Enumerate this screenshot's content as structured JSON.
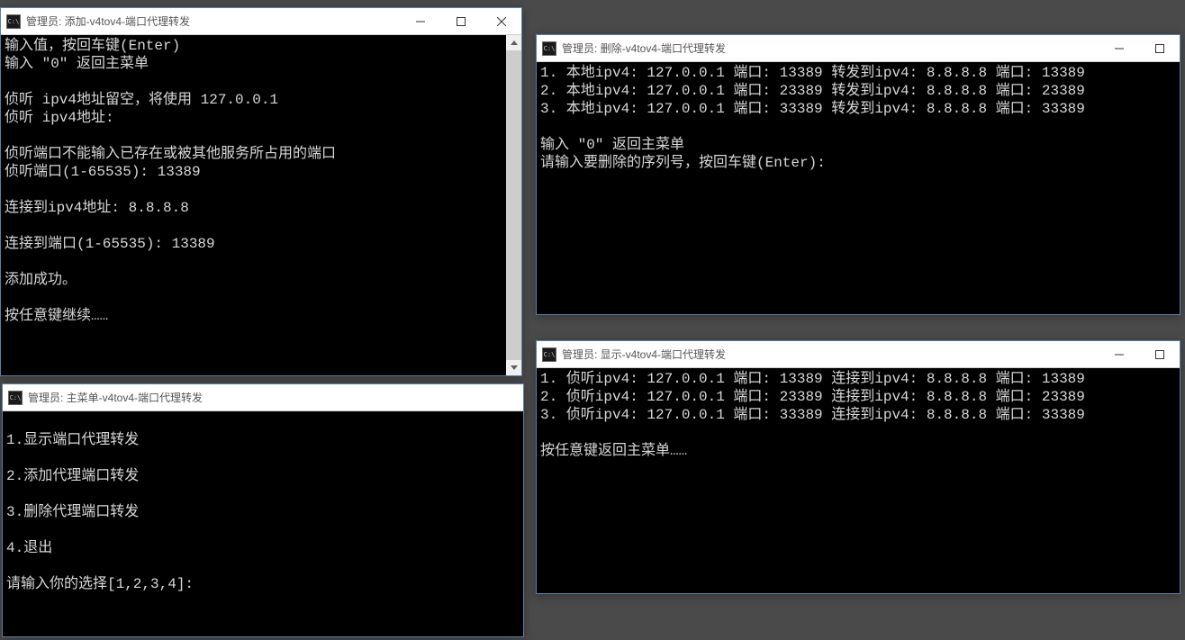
{
  "windows": {
    "add": {
      "title": "管理员: 添加-v4tov4-端口代理转发",
      "lines": [
        "输入值，按回车键(Enter)",
        "输入 \"0\" 返回主菜单",
        "",
        "侦听 ipv4地址留空，将使用 127.0.0.1",
        "侦听 ipv4地址:",
        "",
        "侦听端口不能输入已存在或被其他服务所占用的端口",
        "侦听端口(1-65535): 13389",
        "",
        "连接到ipv4地址: 8.8.8.8",
        "",
        "连接到端口(1-65535): 13389",
        "",
        "添加成功。",
        "",
        "按任意键继续……"
      ]
    },
    "menu": {
      "title": "管理员: 主菜单-v4tov4-端口代理转发",
      "lines": [
        "",
        "1.显示端口代理转发",
        "",
        "2.添加代理端口转发",
        "",
        "3.删除代理端口转发",
        "",
        "4.退出",
        "",
        "请输入你的选择[1,2,3,4]:"
      ]
    },
    "delete": {
      "title": "管理员: 删除-v4tov4-端口代理转发",
      "lines": [
        "1. 本地ipv4: 127.0.0.1 端口: 13389 转发到ipv4: 8.8.8.8 端口: 13389",
        "2. 本地ipv4: 127.0.0.1 端口: 23389 转发到ipv4: 8.8.8.8 端口: 23389",
        "3. 本地ipv4: 127.0.0.1 端口: 33389 转发到ipv4: 8.8.8.8 端口: 33389",
        "",
        "输入 \"0\" 返回主菜单",
        "请输入要删除的序列号，按回车键(Enter):"
      ]
    },
    "show": {
      "title": "管理员: 显示-v4tov4-端口代理转发",
      "lines": [
        "1. 侦听ipv4: 127.0.0.1 端口: 13389 连接到ipv4: 8.8.8.8 端口: 13389",
        "2. 侦听ipv4: 127.0.0.1 端口: 23389 连接到ipv4: 8.8.8.8 端口: 23389",
        "3. 侦听ipv4: 127.0.0.1 端口: 33389 连接到ipv4: 8.8.8.8 端口: 33389",
        "",
        "按任意键返回主菜单……"
      ]
    }
  },
  "icon_label": "C:\\"
}
